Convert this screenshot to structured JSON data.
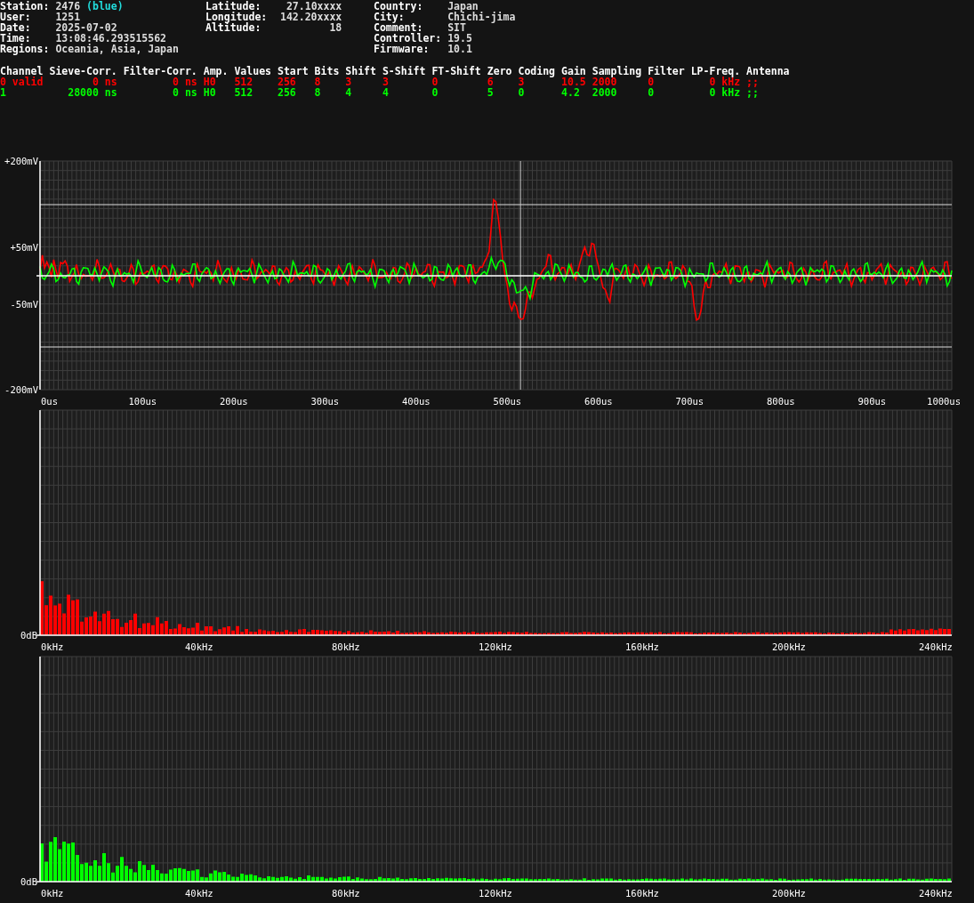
{
  "header": {
    "left": [
      {
        "label": "Station:",
        "value": "2476",
        "tag": "(blue)"
      },
      {
        "label": "User:",
        "value": "1251"
      },
      {
        "label": "Date:",
        "value": "2025-07-02"
      },
      {
        "label": "Time:",
        "value": "13:08:46.293515562"
      },
      {
        "label": "Regions:",
        "value": "Oceania, Asia, Japan"
      }
    ],
    "middle": [
      {
        "label": "Latitude:",
        "value": "27.10xxxx"
      },
      {
        "label": "Longitude:",
        "value": "142.20xxxx"
      },
      {
        "label": "Altitude:",
        "value": "18"
      }
    ],
    "right": [
      {
        "label": "Country:",
        "value": "Japan"
      },
      {
        "label": "City:",
        "value": "Chichi-jima"
      },
      {
        "label": "Comment:",
        "value": "SIT"
      },
      {
        "label": "Controller:",
        "value": "19.5"
      },
      {
        "label": "Firmware:",
        "value": "10.1"
      }
    ]
  },
  "channels": {
    "columns": [
      "Channel",
      "Sieve-Corr.",
      "Filter-Corr.",
      "Amp.",
      "Values",
      "Start",
      "Bits",
      "Shift",
      "S-Shift",
      "FT-Shift",
      "Zero",
      "Coding",
      "Gain",
      "Sampling",
      "Filter",
      "LP-Freq.",
      "Antenna"
    ],
    "rows": [
      {
        "color": "#ff0000",
        "cells": [
          "0 valid",
          "0 ns",
          "0 ns",
          "H0",
          "512",
          "256",
          "8",
          "3",
          "3",
          "0",
          "6",
          "3",
          "10.5",
          "2000",
          "0",
          "0 kHz",
          ";;"
        ]
      },
      {
        "color": "#00ff00",
        "cells": [
          "1",
          "28000 ns",
          "0 ns",
          "H0",
          "512",
          "256",
          "8",
          "4",
          "4",
          "0",
          "5",
          "0",
          "4.2",
          "2000",
          "0",
          "0 kHz",
          ";;"
        ]
      }
    ]
  },
  "waveform": {
    "y_labels": [
      "+200mV",
      "+50mV",
      "-50mV",
      "-200mV"
    ],
    "x_labels": [
      "0us",
      "100us",
      "200us",
      "300us",
      "400us",
      "500us",
      "600us",
      "700us",
      "800us",
      "900us",
      "1000us"
    ]
  },
  "spectra": [
    {
      "color": "#ff0000",
      "y_label": "0dB",
      "x_labels": [
        "0kHz",
        "40kHz",
        "80kHz",
        "120kHz",
        "160kHz",
        "200kHz",
        "240kHz"
      ]
    },
    {
      "color": "#00ff00",
      "y_label": "0dB",
      "x_labels": [
        "0kHz",
        "40kHz",
        "80kHz",
        "120kHz",
        "160kHz",
        "200kHz",
        "240kHz"
      ]
    }
  ]
}
